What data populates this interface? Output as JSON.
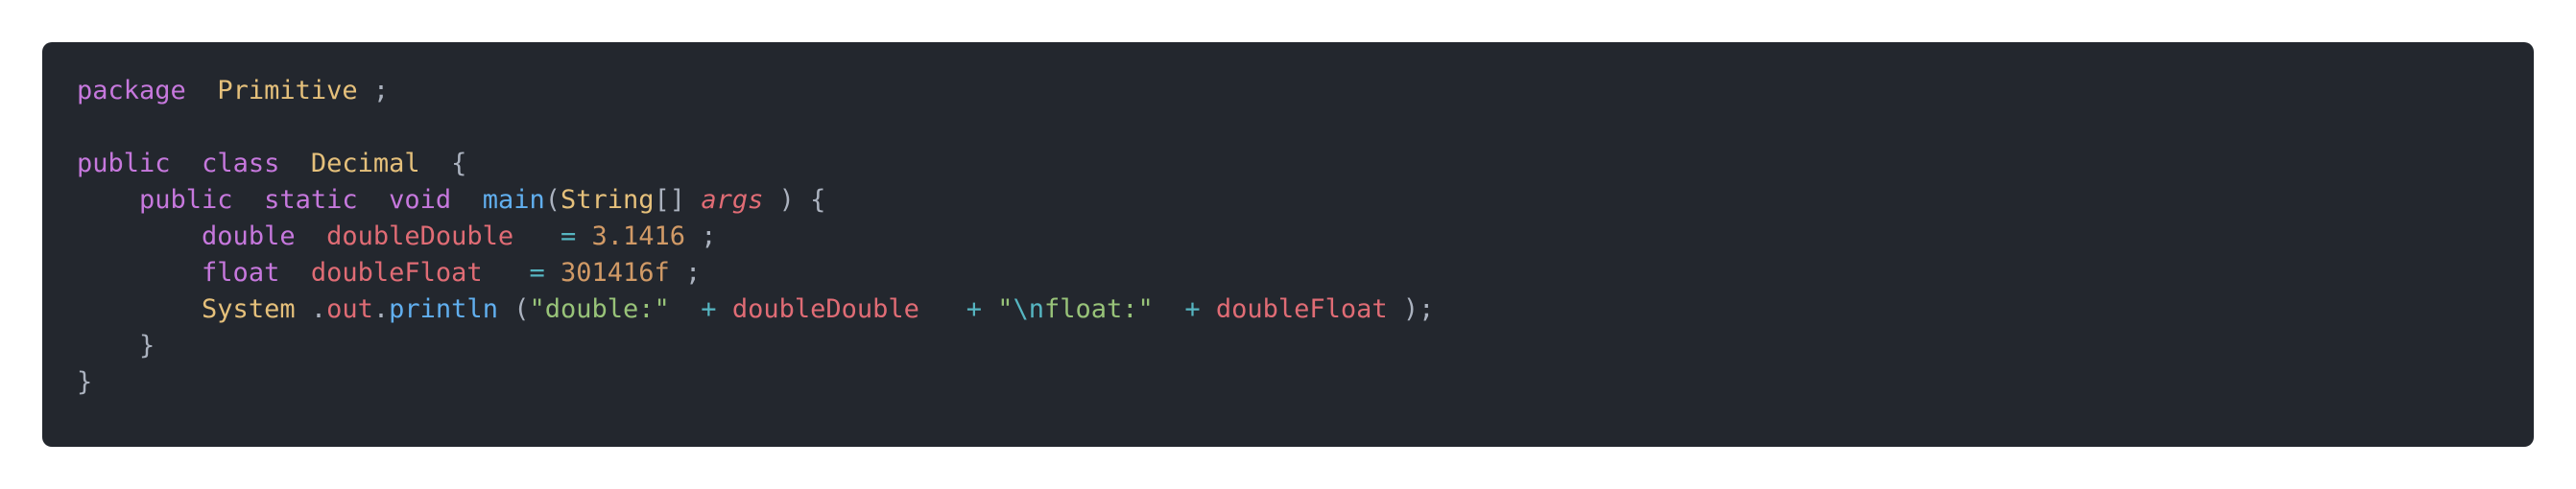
{
  "colors": {
    "page_background": "#ffffff",
    "panel_background": "#23272e",
    "keyword": "#c678dd",
    "type": "#e5c07b",
    "punctuation": "#abb2bf",
    "function": "#61afef",
    "variable": "#e06c75",
    "number": "#d19a66",
    "operator": "#56b6c2",
    "string": "#98c379"
  },
  "code": {
    "language": "java",
    "lines": [
      [
        {
          "t": "package",
          "k": "kw"
        },
        {
          "t": "  ",
          "k": "plain"
        },
        {
          "t": "Primitive",
          "k": "type"
        },
        {
          "t": " ;",
          "k": "plain"
        }
      ],
      [],
      [
        {
          "t": "public",
          "k": "kw"
        },
        {
          "t": "  ",
          "k": "plain"
        },
        {
          "t": "class",
          "k": "kw"
        },
        {
          "t": "  ",
          "k": "plain"
        },
        {
          "t": "Decimal",
          "k": "type"
        },
        {
          "t": "  {",
          "k": "plain"
        }
      ],
      [
        {
          "t": "    ",
          "k": "plain"
        },
        {
          "t": "public",
          "k": "kw"
        },
        {
          "t": "  ",
          "k": "plain"
        },
        {
          "t": "static",
          "k": "kw"
        },
        {
          "t": "  ",
          "k": "plain"
        },
        {
          "t": "void",
          "k": "kw"
        },
        {
          "t": "  ",
          "k": "plain"
        },
        {
          "t": "main",
          "k": "fn"
        },
        {
          "t": "(",
          "k": "plain"
        },
        {
          "t": "String",
          "k": "type"
        },
        {
          "t": "[] ",
          "k": "plain"
        },
        {
          "t": "args",
          "k": "param"
        },
        {
          "t": " ) {",
          "k": "plain"
        }
      ],
      [
        {
          "t": "        ",
          "k": "plain"
        },
        {
          "t": "double",
          "k": "kw"
        },
        {
          "t": "  ",
          "k": "plain"
        },
        {
          "t": "doubleDouble",
          "k": "var"
        },
        {
          "t": "   ",
          "k": "plain"
        },
        {
          "t": "=",
          "k": "op"
        },
        {
          "t": " ",
          "k": "plain"
        },
        {
          "t": "3.1416",
          "k": "num"
        },
        {
          "t": " ;",
          "k": "plain"
        }
      ],
      [
        {
          "t": "        ",
          "k": "plain"
        },
        {
          "t": "float",
          "k": "kw"
        },
        {
          "t": "  ",
          "k": "plain"
        },
        {
          "t": "doubleFloat",
          "k": "var"
        },
        {
          "t": "   ",
          "k": "plain"
        },
        {
          "t": "=",
          "k": "op"
        },
        {
          "t": " ",
          "k": "plain"
        },
        {
          "t": "301416f",
          "k": "num"
        },
        {
          "t": " ;",
          "k": "plain"
        }
      ],
      [
        {
          "t": "        ",
          "k": "plain"
        },
        {
          "t": "System",
          "k": "type"
        },
        {
          "t": " .",
          "k": "plain"
        },
        {
          "t": "out",
          "k": "var"
        },
        {
          "t": ".",
          "k": "plain"
        },
        {
          "t": "println",
          "k": "fn"
        },
        {
          "t": " (",
          "k": "plain"
        },
        {
          "t": "\"double:\"",
          "k": "str"
        },
        {
          "t": "  ",
          "k": "plain"
        },
        {
          "t": "+",
          "k": "op"
        },
        {
          "t": " ",
          "k": "plain"
        },
        {
          "t": "doubleDouble",
          "k": "var"
        },
        {
          "t": "   ",
          "k": "plain"
        },
        {
          "t": "+",
          "k": "op"
        },
        {
          "t": " ",
          "k": "plain"
        },
        {
          "t": "\"",
          "k": "str"
        },
        {
          "t": "\\n",
          "k": "esc"
        },
        {
          "t": "float:\"",
          "k": "str"
        },
        {
          "t": "  ",
          "k": "plain"
        },
        {
          "t": "+",
          "k": "op"
        },
        {
          "t": " ",
          "k": "plain"
        },
        {
          "t": "doubleFloat",
          "k": "var"
        },
        {
          "t": " );",
          "k": "plain"
        }
      ],
      [
        {
          "t": "    }",
          "k": "plain"
        }
      ],
      [
        {
          "t": "}",
          "k": "plain"
        }
      ]
    ]
  }
}
